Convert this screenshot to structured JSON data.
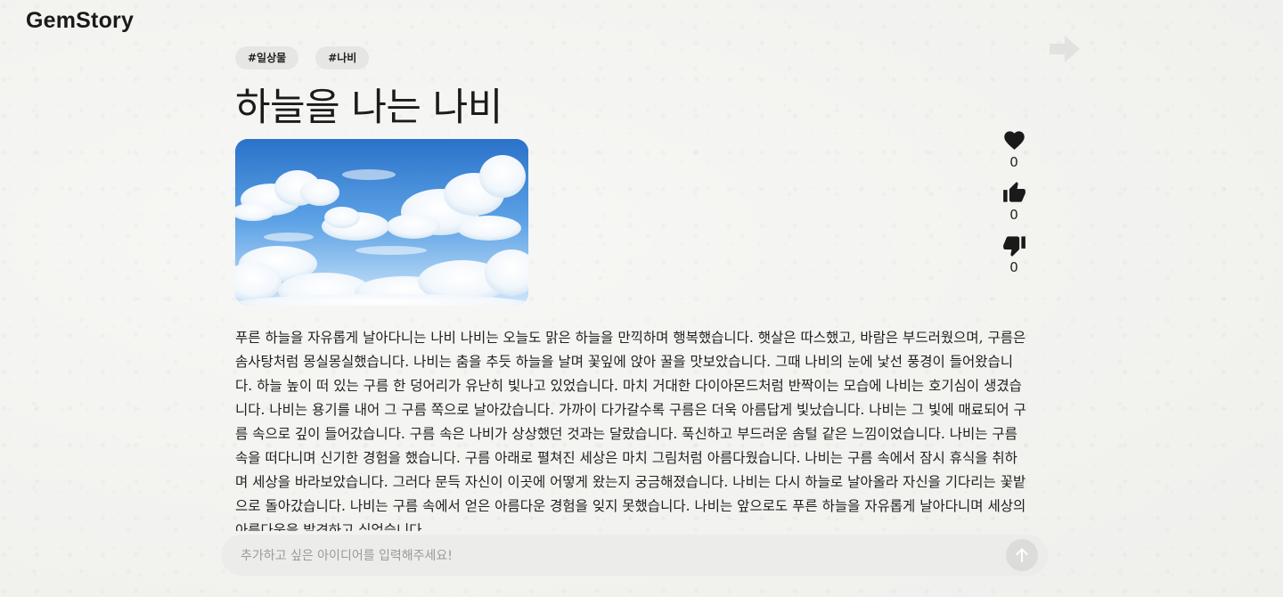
{
  "app": {
    "logo": "GemStory"
  },
  "navigation": {
    "next_icon": "arrow-right-icon"
  },
  "story": {
    "tags": [
      "#일상물",
      "#나비"
    ],
    "title": "하늘을 나는 나비",
    "image_description_icon": "sky-clouds-image",
    "body": "푸른 하늘을 자유롭게 날아다니는 나비 나비는 오늘도 맑은 하늘을 만끽하며 행복했습니다. 햇살은 따스했고, 바람은 부드러웠으며, 구름은 솜사탕처럼 몽실몽실했습니다. 나비는 춤을 추듯 하늘을 날며 꽃잎에 앉아 꿀을 맛보았습니다. 그때 나비의 눈에 낯선 풍경이 들어왔습니다. 하늘 높이 떠 있는 구름 한 덩어리가 유난히 빛나고 있었습니다. 마치 거대한 다이아몬드처럼 반짝이는 모습에 나비는 호기심이 생겼습니다. 나비는 용기를 내어 그 구름 쪽으로 날아갔습니다. 가까이 다가갈수록 구름은 더욱 아름답게 빛났습니다. 나비는 그 빛에 매료되어 구름 속으로 깊이 들어갔습니다. 구름 속은 나비가 상상했던 것과는 달랐습니다. 푹신하고 부드러운 솜털 같은 느낌이었습니다. 나비는 구름 속을 떠다니며 신기한 경험을 했습니다. 구름 아래로 펼쳐진 세상은 마치 그림처럼 아름다웠습니다. 나비는 구름 속에서 잠시 휴식을 취하며 세상을 바라보았습니다. 그러다 문득 자신이 이곳에 어떻게 왔는지 궁금해졌습니다. 나비는 다시 하늘로 날아올라 자신을 기다리는 꽃밭으로 돌아갔습니다. 나비는 구름 속에서 얻은 아름다운 경험을 잊지 못했습니다. 나비는 앞으로도 푸른 하늘을 자유롭게 날아다니며 세상의 아름다움을 발견하고 싶었습니다."
  },
  "reactions": {
    "heart": {
      "icon": "heart-icon",
      "count": "0"
    },
    "like": {
      "icon": "thumbs-up-icon",
      "count": "0"
    },
    "dislike": {
      "icon": "thumbs-down-icon",
      "count": "0"
    }
  },
  "composer": {
    "placeholder": "추가하고 싶은 아이디어를 입력해주세요!",
    "value": "",
    "send_icon": "arrow-up-icon"
  },
  "colors": {
    "background": "#f3f3f1",
    "tag_bg": "#e6e6e4",
    "composer_bg": "#ececea",
    "send_button_bg": "#dcdcda",
    "icon_dark": "#1a1a1a"
  }
}
